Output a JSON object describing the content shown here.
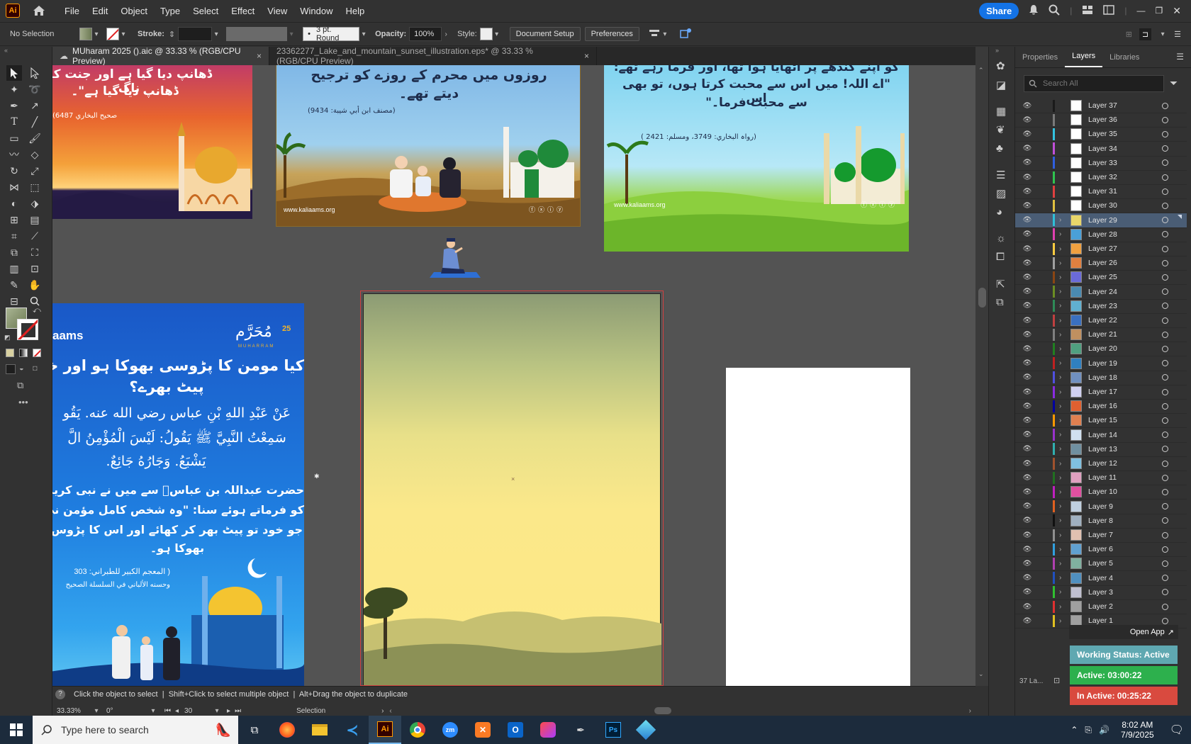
{
  "menubar": {
    "app_logo": "Ai",
    "menu": [
      "File",
      "Edit",
      "Object",
      "Type",
      "Select",
      "Effect",
      "View",
      "Window",
      "Help"
    ],
    "share_label": "Share"
  },
  "controlbar": {
    "selection_label": "No Selection",
    "stroke_label": "Stroke:",
    "brush_label": "3 pt. Round",
    "opacity_label": "Opacity:",
    "opacity_value": "100%",
    "style_label": "Style:",
    "document_setup_label": "Document Setup",
    "preferences_label": "Preferences"
  },
  "tabs": [
    {
      "label": "MUharam 2025 ().aic @ 33.33 % (RGB/CPU Preview)",
      "close": "×"
    },
    {
      "label": "23362277_Lake_and_mountain_sunset_illustration.eps* @ 33.33 % (RGB/CPU Preview)",
      "close": "×"
    }
  ],
  "artboards": {
    "a1": {
      "line1": "ڈھانپ دیا گیا ہے اور جنت کو ناگ",
      "line2": "ڈھانپ دیا گیا ہے\"۔",
      "ref": "(صحيح البخاري 6487"
    },
    "a2": {
      "line1": "روزوں میں محرم کے روزے کو ترجیح",
      "line2": "دیتے تھے۔",
      "ref": "(مصنف ابن أبي شيبة: 9434)",
      "site": "www.kaliaams.org"
    },
    "a3": {
      "line1": "کو اپنے کندھے پر اٹھایا ہوا تھا، اور فرما رہے تھے:",
      "line2": "\"اے اللہ! میں اس سے محبت کرتا ہوں، تو بھی اس",
      "line3": "سے محبت فرما۔\"",
      "ref": "(رواہ البخاري: 3749، ومسلم: 2421 )",
      "site": "www.kaliaams.org"
    },
    "a4": {
      "brand": "aams",
      "badge": "مُحَرَّم",
      "badge_num": "25",
      "badge_sub": "MUHARRAM",
      "q1": "کیا مومن کا پڑوسی بھوکا ہو اور خو",
      "q2": "پیٹ بھرے؟",
      "ar1": "عَنْ عَبْدِ اللهِ بْنِ عباس رضي الله عنه. يَقُو",
      "ar2": "سَمِعْتُ النَّبِيَّ ﷺ يَقُولُ: لَيْسَ الْمُؤْمِنُ الَّ",
      "ar3": "يَشْبَعُ. وَجَارُهُ جَائِعٌ.",
      "u1": "حضرت عبداللہ بن عباسؓ سے میں نے نبی کریم",
      "u2": "کو فرماتے ہوئے سنا: \"وہ شخص کامل مؤمن نہ",
      "u3": "جو خود تو پیٹ بھر کر کھائے اور اس کا پڑوس",
      "u4": "بھوکا ہو۔",
      "ref1": "( المعجم الكبير للطبراني: 303",
      "ref2": "وحسنه الألباني في السلسلة الصحيح"
    }
  },
  "statusbar": {
    "hint": "Click the object to select  |  Shift+Click to select multiple object  |  Alt+Drag the object to duplicate",
    "zoom": "33.33%",
    "rotation": "0°",
    "artboard_num": "30",
    "mode": "Selection"
  },
  "panel": {
    "tabs": [
      "Properties",
      "Layers",
      "Libraries"
    ],
    "search_placeholder": "Search All",
    "layers": [
      {
        "name": "Layer 37",
        "color": "#1a1a1a",
        "thumb": "#ffffff",
        "chev": false
      },
      {
        "name": "Layer 36",
        "color": "#7a7a7a",
        "thumb": "#ffffff",
        "chev": false
      },
      {
        "name": "Layer 35",
        "color": "#33c3e0",
        "thumb": "#ffffff",
        "chev": false
      },
      {
        "name": "Layer 34",
        "color": "#c04fd9",
        "thumb": "#ffffff",
        "chev": false
      },
      {
        "name": "Layer 33",
        "color": "#2f5fe0",
        "thumb": "#ffffff",
        "chev": false
      },
      {
        "name": "Layer 32",
        "color": "#2fc44f",
        "thumb": "#ffffff",
        "chev": false
      },
      {
        "name": "Layer 31",
        "color": "#e04040",
        "thumb": "#ffffff",
        "chev": false
      },
      {
        "name": "Layer 30",
        "color": "#e0c040",
        "thumb": "#ffffff",
        "chev": false
      },
      {
        "name": "Layer 29",
        "color": "#2fc0d9",
        "thumb": "#e8d66a",
        "chev": true
      },
      {
        "name": "Layer 28",
        "color": "#e040b0",
        "thumb": "#4aa0d8",
        "chev": true
      },
      {
        "name": "Layer 27",
        "color": "#ffcc40",
        "thumb": "#f0a040",
        "chev": true
      },
      {
        "name": "Layer 26",
        "color": "#a0a0a0",
        "thumb": "#e08040",
        "chev": true
      },
      {
        "name": "Layer 25",
        "color": "#8b4513",
        "thumb": "#6a6ad8",
        "chev": true
      },
      {
        "name": "Layer 24",
        "color": "#6b8e23",
        "thumb": "#4a8ab0",
        "chev": true
      },
      {
        "name": "Layer 23",
        "color": "#2e8b57",
        "thumb": "#60b0d0",
        "chev": true
      },
      {
        "name": "Layer 22",
        "color": "#c04040",
        "thumb": "#3a70c0",
        "chev": true
      },
      {
        "name": "Layer 21",
        "color": "#808080",
        "thumb": "#c09060",
        "chev": true
      },
      {
        "name": "Layer 20",
        "color": "#208020",
        "thumb": "#50a080",
        "chev": true
      },
      {
        "name": "Layer 19",
        "color": "#c02020",
        "thumb": "#3080c0",
        "chev": true
      },
      {
        "name": "Layer 18",
        "color": "#5050e0",
        "thumb": "#7090c0",
        "chev": true
      },
      {
        "name": "Layer 17",
        "color": "#8a2be2",
        "thumb": "#d0d0f0",
        "chev": true
      },
      {
        "name": "Layer 16",
        "color": "#0000a0",
        "thumb": "#e06030",
        "chev": true
      },
      {
        "name": "Layer 15",
        "color": "#ff9900",
        "thumb": "#e08050",
        "chev": true
      },
      {
        "name": "Layer 14",
        "color": "#9932cc",
        "thumb": "#d0e0f0",
        "chev": true
      },
      {
        "name": "Layer 13",
        "color": "#30b0b0",
        "thumb": "#7090a0",
        "chev": true
      },
      {
        "name": "Layer 12",
        "color": "#a0522d",
        "thumb": "#80c0e0",
        "chev": true
      },
      {
        "name": "Layer 11",
        "color": "#207020",
        "thumb": "#e0a0c0",
        "chev": true
      },
      {
        "name": "Layer 10",
        "color": "#c020c0",
        "thumb": "#e050a0",
        "chev": true
      },
      {
        "name": "Layer 9",
        "color": "#e06020",
        "thumb": "#c0d0e0",
        "chev": true
      },
      {
        "name": "Layer 8",
        "color": "#101010",
        "thumb": "#a0b0c0",
        "chev": true
      },
      {
        "name": "Layer 7",
        "color": "#909090",
        "thumb": "#e0c0b0",
        "chev": true
      },
      {
        "name": "Layer 6",
        "color": "#30a0e0",
        "thumb": "#60a0d0",
        "chev": true
      },
      {
        "name": "Layer 5",
        "color": "#b040b0",
        "thumb": "#80b0a0",
        "chev": true
      },
      {
        "name": "Layer 4",
        "color": "#2050c0",
        "thumb": "#5090c0",
        "chev": true
      },
      {
        "name": "Layer 3",
        "color": "#30c030",
        "thumb": "#c0c0d0",
        "chev": true
      },
      {
        "name": "Layer 2",
        "color": "#e03030",
        "thumb": "#a0a0a0",
        "chev": true
      },
      {
        "name": "Layer 1",
        "color": "#e0c020",
        "thumb": "#a0a0a0",
        "chev": true
      }
    ],
    "layer_count": "37 La..."
  },
  "overlay": {
    "open_app": "Open App",
    "working_status": "Working Status: Active",
    "active": "Active: 03:00:22",
    "inactive": "In Active: 00:25:22"
  },
  "taskbar": {
    "search_placeholder": "Type here to search",
    "time": "8:02 AM",
    "date": "7/9/2025"
  }
}
